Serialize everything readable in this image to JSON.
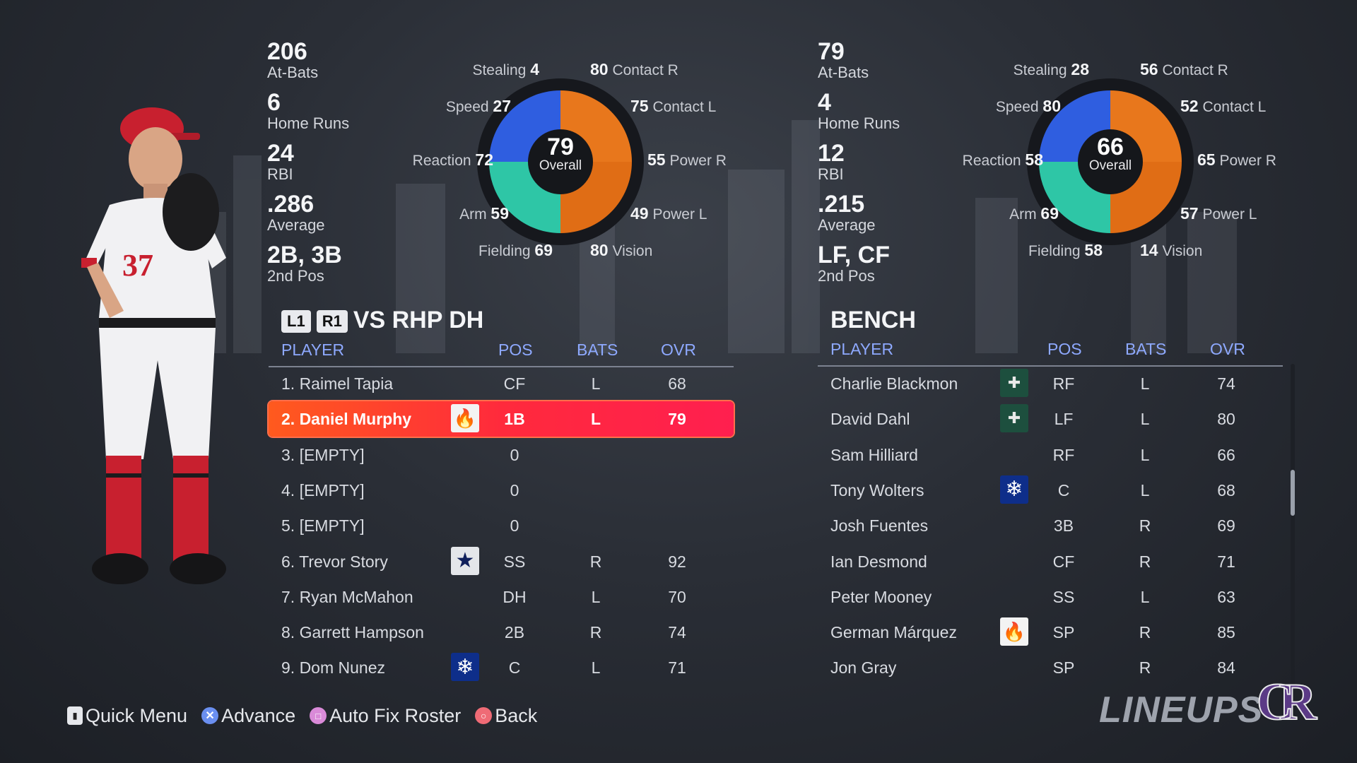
{
  "left_player": {
    "jersey_number": "37",
    "stats": [
      {
        "value": "206",
        "label": "At-Bats"
      },
      {
        "value": "6",
        "label": "Home Runs"
      },
      {
        "value": "24",
        "label": "RBI"
      },
      {
        "value": ".286",
        "label": "Average"
      },
      {
        "value": "2B, 3B",
        "label": "2nd Pos"
      }
    ],
    "overall": {
      "value": "79",
      "label": "Overall"
    },
    "attributes": {
      "stealing": {
        "label": "Stealing",
        "value": "4"
      },
      "speed": {
        "label": "Speed",
        "value": "27"
      },
      "reaction": {
        "label": "Reaction",
        "value": "72"
      },
      "arm": {
        "label": "Arm",
        "value": "59"
      },
      "fielding": {
        "label": "Fielding",
        "value": "69"
      },
      "contact_r": {
        "label": "Contact R",
        "value": "80"
      },
      "contact_l": {
        "label": "Contact L",
        "value": "75"
      },
      "power_r": {
        "label": "Power R",
        "value": "55"
      },
      "power_l": {
        "label": "Power L",
        "value": "49"
      },
      "vision": {
        "label": "Vision",
        "value": "80"
      }
    }
  },
  "right_player": {
    "stats": [
      {
        "value": "79",
        "label": "At-Bats"
      },
      {
        "value": "4",
        "label": "Home Runs"
      },
      {
        "value": "12",
        "label": "RBI"
      },
      {
        "value": ".215",
        "label": "Average"
      },
      {
        "value": "LF, CF",
        "label": "2nd Pos"
      }
    ],
    "overall": {
      "value": "66",
      "label": "Overall"
    },
    "attributes": {
      "stealing": {
        "label": "Stealing",
        "value": "28"
      },
      "speed": {
        "label": "Speed",
        "value": "80"
      },
      "reaction": {
        "label": "Reaction",
        "value": "58"
      },
      "arm": {
        "label": "Arm",
        "value": "69"
      },
      "fielding": {
        "label": "Fielding",
        "value": "58"
      },
      "contact_r": {
        "label": "Contact R",
        "value": "56"
      },
      "contact_l": {
        "label": "Contact L",
        "value": "52"
      },
      "power_r": {
        "label": "Power R",
        "value": "65"
      },
      "power_l": {
        "label": "Power L",
        "value": "57"
      },
      "vision": {
        "label": "Vision",
        "value": "14"
      }
    }
  },
  "lineup": {
    "badge_l": "L1",
    "badge_r": "R1",
    "title": "VS RHP DH",
    "headers": {
      "player": "PLAYER",
      "pos": "POS",
      "bats": "BATS",
      "ovr": "OVR"
    },
    "rows": [
      {
        "name": "1. Raimel Tapia",
        "pos": "CF",
        "bats": "L",
        "ovr": "68",
        "icon": ""
      },
      {
        "name": "2. Daniel Murphy",
        "pos": "1B",
        "bats": "L",
        "ovr": "79",
        "icon": "fire-icon"
      },
      {
        "name": "3. [EMPTY]",
        "pos": "0",
        "bats": "",
        "ovr": "",
        "icon": ""
      },
      {
        "name": "4. [EMPTY]",
        "pos": "0",
        "bats": "",
        "ovr": "",
        "icon": ""
      },
      {
        "name": "5. [EMPTY]",
        "pos": "0",
        "bats": "",
        "ovr": "",
        "icon": ""
      },
      {
        "name": "6. Trevor Story",
        "pos": "SS",
        "bats": "R",
        "ovr": "92",
        "icon": "star-icon"
      },
      {
        "name": "7. Ryan McMahon",
        "pos": "DH",
        "bats": "L",
        "ovr": "70",
        "icon": ""
      },
      {
        "name": "8. Garrett Hampson",
        "pos": "2B",
        "bats": "R",
        "ovr": "74",
        "icon": ""
      },
      {
        "name": "9. Dom Nunez",
        "pos": "C",
        "bats": "L",
        "ovr": "71",
        "icon": "snowflake-icon"
      }
    ]
  },
  "bench": {
    "title": "BENCH",
    "headers": {
      "player": "PLAYER",
      "pos": "POS",
      "bats": "BATS",
      "ovr": "OVR"
    },
    "rows": [
      {
        "name": "Charlie Blackmon",
        "pos": "RF",
        "bats": "L",
        "ovr": "74",
        "icon": "bandage-icon"
      },
      {
        "name": "David Dahl",
        "pos": "LF",
        "bats": "L",
        "ovr": "80",
        "icon": "bandage-icon"
      },
      {
        "name": "Sam Hilliard",
        "pos": "RF",
        "bats": "L",
        "ovr": "66",
        "icon": ""
      },
      {
        "name": "Tony Wolters",
        "pos": "C",
        "bats": "L",
        "ovr": "68",
        "icon": "snowflake-icon"
      },
      {
        "name": "Josh Fuentes",
        "pos": "3B",
        "bats": "R",
        "ovr": "69",
        "icon": ""
      },
      {
        "name": "Ian Desmond",
        "pos": "CF",
        "bats": "R",
        "ovr": "71",
        "icon": ""
      },
      {
        "name": "Peter Mooney",
        "pos": "SS",
        "bats": "L",
        "ovr": "63",
        "icon": ""
      },
      {
        "name": "German Márquez",
        "pos": "SP",
        "bats": "R",
        "ovr": "85",
        "icon": "fire-icon"
      },
      {
        "name": "Jon Gray",
        "pos": "SP",
        "bats": "R",
        "ovr": "84",
        "icon": ""
      }
    ]
  },
  "footer": {
    "quick_menu": "Quick Menu",
    "advance": "Advance",
    "auto_fix": "Auto Fix Roster",
    "back": "Back"
  },
  "branding": {
    "screen_title": "LINEUPS",
    "team_logo": "CR"
  },
  "colors": {
    "selected_row": "#ff2a3c",
    "header_blue": "#8ea9ff",
    "wheel_blue": "#2f5ee0",
    "wheel_orange": "#e8771c",
    "wheel_teal": "#2ec6a6"
  }
}
